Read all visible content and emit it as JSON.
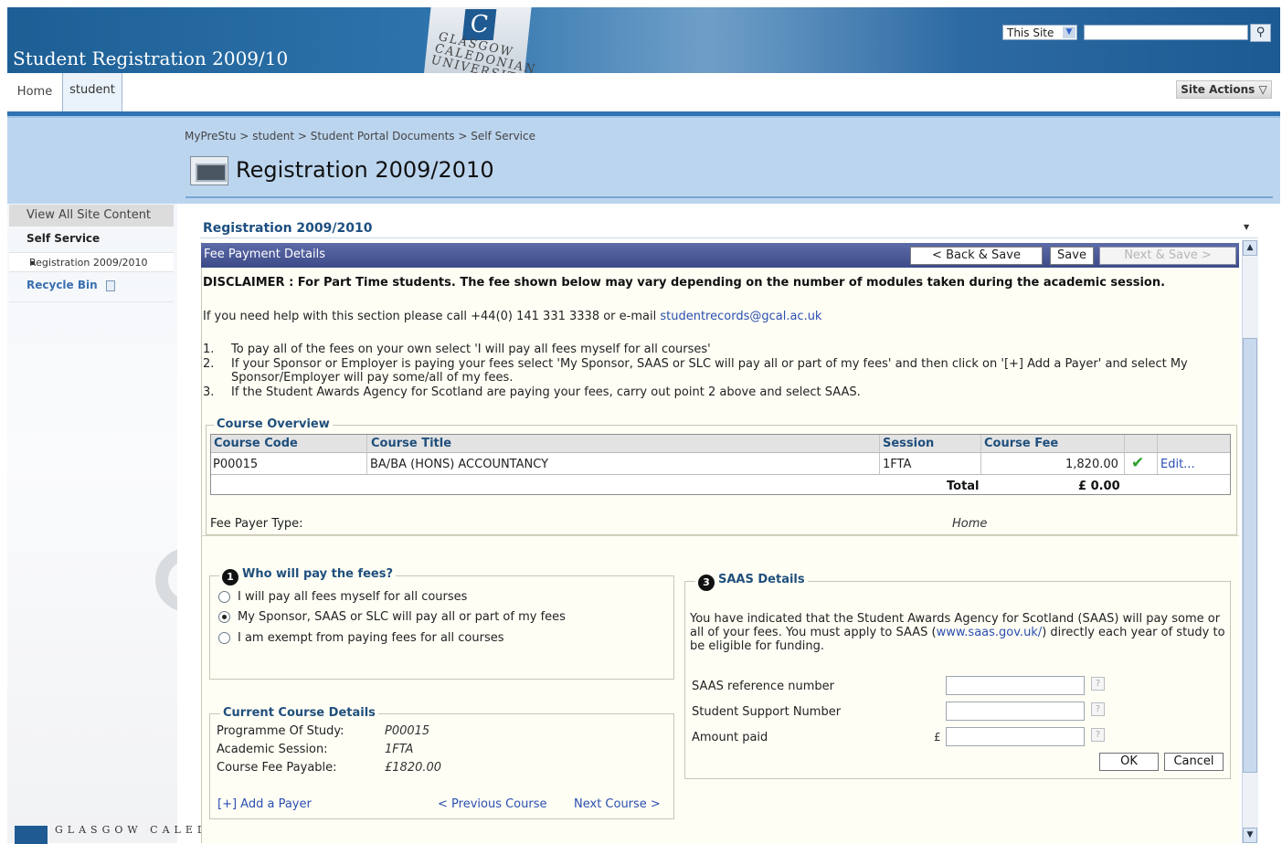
{
  "site": {
    "title": "Student Registration 2009/10",
    "logo_text": "GLASGOW CALEDONIAN UNIVERSITY",
    "scope_select": "This Site",
    "search_placeholder": ""
  },
  "topnav": {
    "tabs": [
      {
        "label": "Home"
      },
      {
        "label": "student"
      }
    ],
    "site_actions": "Site Actions"
  },
  "breadcrumb": {
    "items": [
      "MyPreStu",
      "student",
      "Student Portal Documents",
      "Self Service"
    ],
    "separator": ">"
  },
  "page": {
    "title": "Registration 2009/2010"
  },
  "leftnav": {
    "view_all": "View All Site Content",
    "section": "Self Service",
    "items": [
      "Registration 2009/2010"
    ],
    "recycle": "Recycle Bin",
    "bottom_logo": "GLASGOW CALEDONIAN"
  },
  "webpart": {
    "title": "Registration 2009/2010",
    "header": "Fee Payment Details",
    "buttons": {
      "back": "< Back & Save",
      "save": "Save",
      "next": "Next & Save >"
    }
  },
  "content": {
    "disclaimer": "DISCLAIMER : For Part Time students. The fee shown below may vary depending on the number of modules taken during the academic session.",
    "help_prefix": "If you need help with this section please call +44(0) 141 331 3338 or e-mail ",
    "help_email": "studentrecords@gcal.ac.uk",
    "instructions": [
      {
        "num": "1.",
        "text": "To pay all of the fees on your own select 'I will pay all fees myself for all courses'"
      },
      {
        "num": "2.",
        "text": "If your Sponsor or Employer is paying your fees select 'My Sponsor, SAAS or SLC will pay all or part of my fees' and then click on '[+] Add a Payer' and select My Sponsor/Employer will pay some/all of my fees."
      },
      {
        "num": "3.",
        "text": "If the Student Awards Agency for Scotland are paying your fees, carry out point 2 above and select SAAS."
      }
    ]
  },
  "course_overview": {
    "legend": "Course Overview",
    "columns": [
      "Course Code",
      "Course Title",
      "Session",
      "Course Fee"
    ],
    "rows": [
      {
        "code": "P00015",
        "title": "BA/BA (HONS) ACCOUNTANCY",
        "session": "1FTA",
        "fee": "1,820.00",
        "edit": "Edit..."
      }
    ],
    "total_label": "Total",
    "total_value": "£ 0.00",
    "fee_payer_type_label": "Fee Payer Type:",
    "fee_payer_type_value": "Home"
  },
  "who_pays": {
    "number": "1",
    "legend": "Who will pay the fees?",
    "options": [
      {
        "label": "I will pay all fees myself for all courses",
        "selected": false
      },
      {
        "label": "My Sponsor, SAAS or SLC will pay all or part of my fees",
        "selected": true
      },
      {
        "label": "I am exempt from paying fees for all courses",
        "selected": false
      }
    ]
  },
  "current_course": {
    "legend": "Current Course Details",
    "fields": [
      {
        "label": "Programme Of Study:",
        "value": "P00015"
      },
      {
        "label": "Academic Session:",
        "value": "1FTA"
      },
      {
        "label": "Course Fee Payable:",
        "value": "£1820.00"
      }
    ],
    "add_payer": "[+] Add a Payer",
    "prev_course": "< Previous Course",
    "next_course": "Next Course >"
  },
  "saas": {
    "number": "3",
    "legend": "SAAS Details",
    "text_prefix": "You have indicated that the Student Awards Agency for Scotland (SAAS) will pay some or all of your fees. You must apply to SAAS (",
    "link": "www.saas.gov.uk/",
    "text_suffix": ") directly each year of study to be eligible for funding.",
    "fields": [
      {
        "label": "SAAS reference number",
        "value": ""
      },
      {
        "label": "Student Support Number",
        "value": ""
      },
      {
        "label": "Amount paid",
        "value": "",
        "prefix": "£"
      }
    ],
    "help_glyph": "?",
    "ok": "OK",
    "cancel": "Cancel"
  }
}
